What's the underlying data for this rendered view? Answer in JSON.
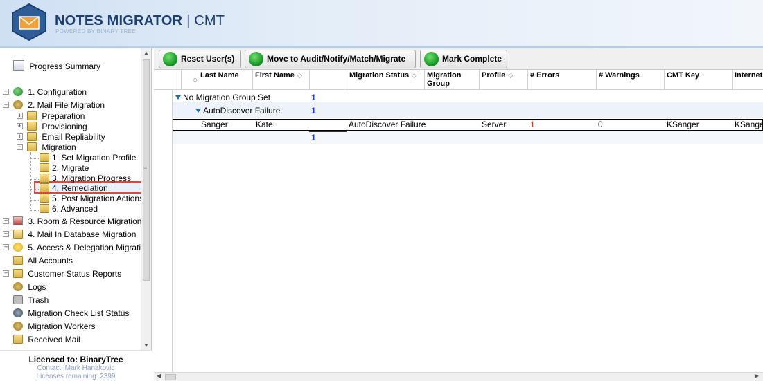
{
  "header": {
    "brand": "NOTES MIGRATOR",
    "separator": "|",
    "product": "CMT",
    "powered_by": "POWERED BY BINARY TREE"
  },
  "sidebar": {
    "progress_summary": "Progress Summary",
    "items": {
      "configuration": "1. Configuration",
      "mail_file_migration": "2. Mail File Migration",
      "preparation": "Preparation",
      "provisioning": "Provisioning",
      "email_repliability": "Email Repliability",
      "migration": "Migration",
      "set_migration_profile": "1. Set Migration Profile",
      "migrate": "2. Migrate",
      "migration_progress": "3. Migration Progress",
      "remediation": "4. Remediation",
      "post_migration_actions": "5. Post Migration Actions",
      "advanced": "6. Advanced",
      "room_resource": "3. Room & Resource Migration",
      "mail_in_db": "4. Mail In Database Migration",
      "access_delegation": "5. Access & Delegation Migrati",
      "all_accounts": "All Accounts",
      "customer_status_reports": "Customer Status Reports",
      "logs": "Logs",
      "trash": "Trash",
      "migration_check_list_status": "Migration Check List Status",
      "migration_workers": "Migration Workers",
      "received_mail": "Received Mail"
    },
    "selected": "4. Remediation"
  },
  "license": {
    "licensed_to": "Licensed to: BinaryTree",
    "contact": "Contact: Mark Hanakovic",
    "remaining": "Licenses remaining: 2399"
  },
  "toolbar": {
    "reset_users": "Reset User(s)",
    "move_to": "Move to Audit/Notify/Match/Migrate",
    "mark_complete": "Mark Complete"
  },
  "grid": {
    "columns": {
      "last_name": "Last Name",
      "first_name": "First Name",
      "migration_status": "Migration Status",
      "migration_group_1": "Migration",
      "migration_group_2": "Group",
      "profile": "Profile",
      "errors": "# Errors",
      "warnings": "# Warnings",
      "cmt_key": "CMT Key",
      "internet": "Internet A"
    },
    "sort_glyph": "◇",
    "groups": {
      "level1_label": "No Migration Group Set",
      "level1_count": "1",
      "level2_label": "AutoDiscover Failure",
      "level2_count": "1",
      "footer_count": "1"
    },
    "row": {
      "last_name": "Sanger",
      "first_name": "Kate",
      "migration_status": "AutoDiscover Failure",
      "profile": "Server",
      "errors": "1",
      "warnings": "0",
      "cmt_key": "KSanger",
      "internet": "KSange"
    }
  },
  "colors": {
    "brand_text": "#1c3f73",
    "selection_outline": "#d9483b",
    "group_count": "#1d3fd0",
    "error_count": "#d0361c",
    "button_green": "#0f8f1f"
  }
}
